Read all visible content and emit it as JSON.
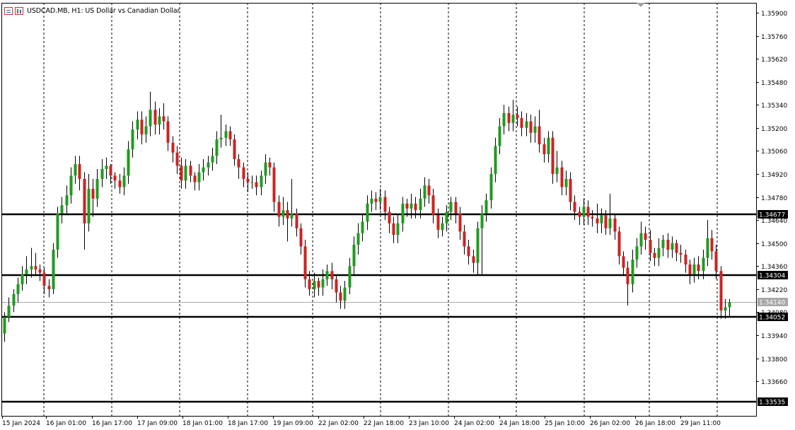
{
  "header": {
    "title": "USDCAD.MB, H1:  US Dollar vs Canadian Dollar",
    "icons": [
      "one-click-trading-icon",
      "chart-bars-icon"
    ]
  },
  "colors": {
    "bull": "#1f9b1f",
    "bear": "#cc2222",
    "wick": "#000000",
    "grid": "#000000",
    "level_line": "#000000",
    "bid_line": "#a8a8a8"
  },
  "chart_data": {
    "type": "candlestick",
    "title": "USDCAD.MB, H1:  US Dollar vs Canadian Dollar",
    "symbol": "USDCAD.MB",
    "timeframe": "H1",
    "ylim": [
      1.3345,
      1.3596
    ],
    "y_ticks": [
      "1.35900",
      "1.35760",
      "1.35620",
      "1.35480",
      "1.35340",
      "1.35200",
      "1.35060",
      "1.34920",
      "1.34780",
      "1.34640",
      "1.34500",
      "1.34360",
      "1.34220",
      "1.34080",
      "1.33940",
      "1.33800",
      "1.33660"
    ],
    "x_ticks": [
      "15 Jan 2024",
      "16 Jan 01:00",
      "16 Jan 17:00",
      "17 Jan 09:00",
      "18 Jan 01:00",
      "18 Jan 17:00",
      "19 Jan 09:00",
      "22 Jan 02:00",
      "22 Jan 18:00",
      "23 Jan 10:00",
      "24 Jan 02:00",
      "24 Jan 18:00",
      "25 Jan 10:00",
      "26 Jan 02:00",
      "26 Jan 18:00",
      "29 Jan 11:00"
    ],
    "grid": "vertical dashed",
    "levels": [
      "1.34677",
      "1.34304",
      "1.34052",
      "1.33535"
    ],
    "current_price": "1.34140",
    "candles": [
      [
        1.3395,
        1.3405,
        1.339,
        1.3408
      ],
      [
        1.3405,
        1.3412,
        1.3402,
        1.3417
      ],
      [
        1.3412,
        1.3419,
        1.3408,
        1.3422
      ],
      [
        1.3419,
        1.3425,
        1.3414,
        1.3429
      ],
      [
        1.3425,
        1.3431,
        1.3421,
        1.3436
      ],
      [
        1.3431,
        1.3434,
        1.3425,
        1.3442
      ],
      [
        1.3434,
        1.3436,
        1.3429,
        1.3447
      ],
      [
        1.3436,
        1.3434,
        1.343,
        1.3444
      ],
      [
        1.3434,
        1.3432,
        1.3427,
        1.3437
      ],
      [
        1.3432,
        1.3424,
        1.3419,
        1.3435
      ],
      [
        1.3424,
        1.3422,
        1.3417,
        1.3428
      ],
      [
        1.3422,
        1.3446,
        1.3419,
        1.345
      ],
      [
        1.3446,
        1.3468,
        1.3441,
        1.3472
      ],
      [
        1.3468,
        1.3473,
        1.3462,
        1.3478
      ],
      [
        1.3473,
        1.3479,
        1.3467,
        1.3485
      ],
      [
        1.3479,
        1.3491,
        1.3474,
        1.3496
      ],
      [
        1.3491,
        1.3498,
        1.3486,
        1.3503
      ],
      [
        1.3498,
        1.3489,
        1.3482,
        1.3503
      ],
      [
        1.3489,
        1.3462,
        1.3446,
        1.3493
      ],
      [
        1.3462,
        1.3483,
        1.3457,
        1.3492
      ],
      [
        1.3483,
        1.3477,
        1.3466,
        1.3489
      ],
      [
        1.3477,
        1.3489,
        1.3472,
        1.3495
      ],
      [
        1.3489,
        1.3495,
        1.3484,
        1.3501
      ],
      [
        1.3495,
        1.3497,
        1.3489,
        1.3502
      ],
      [
        1.3497,
        1.3491,
        1.3486,
        1.3498
      ],
      [
        1.3491,
        1.3488,
        1.3483,
        1.3493
      ],
      [
        1.3488,
        1.3484,
        1.348,
        1.3492
      ],
      [
        1.3484,
        1.3491,
        1.3479,
        1.3496
      ],
      [
        1.3491,
        1.3507,
        1.3486,
        1.3512
      ],
      [
        1.3507,
        1.3519,
        1.3502,
        1.3524
      ],
      [
        1.3519,
        1.3525,
        1.3513,
        1.353
      ],
      [
        1.3525,
        1.3516,
        1.351,
        1.353
      ],
      [
        1.3516,
        1.3521,
        1.3511,
        1.3527
      ],
      [
        1.3521,
        1.3531,
        1.3515,
        1.3542
      ],
      [
        1.3531,
        1.3522,
        1.3516,
        1.3536
      ],
      [
        1.3522,
        1.3527,
        1.3516,
        1.3532
      ],
      [
        1.3527,
        1.3524,
        1.3519,
        1.3535
      ],
      [
        1.3524,
        1.3511,
        1.3506,
        1.3527
      ],
      [
        1.3511,
        1.3505,
        1.3499,
        1.3515
      ],
      [
        1.3505,
        1.3497,
        1.3492,
        1.3509
      ],
      [
        1.3497,
        1.3488,
        1.3483,
        1.3502
      ],
      [
        1.3488,
        1.3497,
        1.3483,
        1.3501
      ],
      [
        1.3497,
        1.3491,
        1.3487,
        1.35
      ],
      [
        1.3491,
        1.3487,
        1.3482,
        1.3493
      ],
      [
        1.3487,
        1.3493,
        1.3482,
        1.3498
      ],
      [
        1.3493,
        1.3496,
        1.3488,
        1.3501
      ],
      [
        1.3496,
        1.3499,
        1.3491,
        1.3503
      ],
      [
        1.3499,
        1.3503,
        1.3494,
        1.3508
      ],
      [
        1.3503,
        1.3513,
        1.3498,
        1.3518
      ],
      [
        1.3513,
        1.3514,
        1.3508,
        1.3528
      ],
      [
        1.3514,
        1.3518,
        1.3509,
        1.3522
      ],
      [
        1.3518,
        1.3513,
        1.3509,
        1.3521
      ],
      [
        1.3513,
        1.3501,
        1.3497,
        1.3516
      ],
      [
        1.3501,
        1.3496,
        1.3489,
        1.3504
      ],
      [
        1.3496,
        1.3489,
        1.3484,
        1.3499
      ],
      [
        1.3489,
        1.3487,
        1.3481,
        1.3493
      ],
      [
        1.3487,
        1.3487,
        1.3483,
        1.3491
      ],
      [
        1.3487,
        1.3484,
        1.3479,
        1.3491
      ],
      [
        1.3484,
        1.3491,
        1.3479,
        1.3494
      ],
      [
        1.3491,
        1.3499,
        1.3486,
        1.3504
      ],
      [
        1.3499,
        1.3496,
        1.3491,
        1.3502
      ],
      [
        1.3496,
        1.3475,
        1.3469,
        1.3499
      ],
      [
        1.3475,
        1.3466,
        1.346,
        1.3479
      ],
      [
        1.3466,
        1.347,
        1.3461,
        1.3478
      ],
      [
        1.347,
        1.3465,
        1.3451,
        1.3475
      ],
      [
        1.3465,
        1.3468,
        1.346,
        1.3489
      ],
      [
        1.3468,
        1.3459,
        1.3454,
        1.3471
      ],
      [
        1.3459,
        1.3448,
        1.3443,
        1.3462
      ],
      [
        1.3448,
        1.3428,
        1.3423,
        1.3452
      ],
      [
        1.3428,
        1.3422,
        1.3418,
        1.3433
      ],
      [
        1.3422,
        1.3427,
        1.3417,
        1.3432
      ],
      [
        1.3427,
        1.3423,
        1.3418,
        1.3429
      ],
      [
        1.3423,
        1.3428,
        1.3418,
        1.3434
      ],
      [
        1.3428,
        1.3433,
        1.3424,
        1.3437
      ],
      [
        1.3433,
        1.3428,
        1.3422,
        1.3438
      ],
      [
        1.3428,
        1.342,
        1.3414,
        1.3431
      ],
      [
        1.342,
        1.3415,
        1.341,
        1.3424
      ],
      [
        1.3415,
        1.3423,
        1.341,
        1.3427
      ],
      [
        1.3423,
        1.3436,
        1.3419,
        1.3441
      ],
      [
        1.3436,
        1.3449,
        1.343,
        1.3454
      ],
      [
        1.3449,
        1.3456,
        1.3443,
        1.3462
      ],
      [
        1.3456,
        1.3463,
        1.3451,
        1.3468
      ],
      [
        1.3463,
        1.3474,
        1.3458,
        1.3479
      ],
      [
        1.3474,
        1.3477,
        1.3469,
        1.3482
      ],
      [
        1.3477,
        1.3475,
        1.347,
        1.3481
      ],
      [
        1.3475,
        1.3478,
        1.347,
        1.3483
      ],
      [
        1.3478,
        1.3469,
        1.3464,
        1.3482
      ],
      [
        1.3469,
        1.3462,
        1.3456,
        1.3472
      ],
      [
        1.3462,
        1.3455,
        1.345,
        1.3466
      ],
      [
        1.3455,
        1.3462,
        1.345,
        1.3467
      ],
      [
        1.3462,
        1.3474,
        1.3457,
        1.3478
      ],
      [
        1.3474,
        1.3471,
        1.3466,
        1.3477
      ],
      [
        1.3471,
        1.3474,
        1.3465,
        1.348
      ],
      [
        1.3474,
        1.347,
        1.3465,
        1.3478
      ],
      [
        1.347,
        1.3477,
        1.3465,
        1.3483
      ],
      [
        1.3477,
        1.3485,
        1.3472,
        1.349
      ],
      [
        1.3485,
        1.3479,
        1.3474,
        1.3489
      ],
      [
        1.3479,
        1.3467,
        1.3462,
        1.3483
      ],
      [
        1.3467,
        1.3458,
        1.3453,
        1.3471
      ],
      [
        1.3458,
        1.3462,
        1.3454,
        1.3466
      ],
      [
        1.3462,
        1.3469,
        1.3457,
        1.3473
      ],
      [
        1.3469,
        1.3475,
        1.3464,
        1.3478
      ],
      [
        1.3475,
        1.3468,
        1.3462,
        1.3478
      ],
      [
        1.3468,
        1.3457,
        1.3452,
        1.3472
      ],
      [
        1.3457,
        1.3448,
        1.3443,
        1.3461
      ],
      [
        1.3448,
        1.3442,
        1.3437,
        1.3452
      ],
      [
        1.3442,
        1.3438,
        1.3432,
        1.3446
      ],
      [
        1.3438,
        1.3459,
        1.3431,
        1.3463
      ],
      [
        1.3459,
        1.3468,
        1.3431,
        1.3473
      ],
      [
        1.3468,
        1.3476,
        1.3463,
        1.348
      ],
      [
        1.3476,
        1.3492,
        1.3471,
        1.3496
      ],
      [
        1.3492,
        1.3509,
        1.3487,
        1.3514
      ],
      [
        1.3509,
        1.3521,
        1.3504,
        1.3526
      ],
      [
        1.3521,
        1.3529,
        1.3516,
        1.3534
      ],
      [
        1.3529,
        1.3523,
        1.3518,
        1.3533
      ],
      [
        1.3523,
        1.3528,
        1.3518,
        1.3537
      ],
      [
        1.3528,
        1.3526,
        1.3521,
        1.3533
      ],
      [
        1.3526,
        1.352,
        1.3515,
        1.353
      ],
      [
        1.352,
        1.3524,
        1.3515,
        1.3529
      ],
      [
        1.3524,
        1.3517,
        1.3511,
        1.3528
      ],
      [
        1.3517,
        1.3521,
        1.3511,
        1.3527
      ],
      [
        1.3521,
        1.351,
        1.3505,
        1.3531
      ],
      [
        1.351,
        1.3504,
        1.3499,
        1.3514
      ],
      [
        1.3504,
        1.3514,
        1.3499,
        1.3518
      ],
      [
        1.3514,
        1.3492,
        1.3486,
        1.3518
      ],
      [
        1.3492,
        1.3496,
        1.3487,
        1.3506
      ],
      [
        1.3496,
        1.3484,
        1.3479,
        1.35
      ],
      [
        1.3484,
        1.3489,
        1.3479,
        1.3494
      ],
      [
        1.3489,
        1.3475,
        1.347,
        1.3493
      ],
      [
        1.3475,
        1.3469,
        1.3464,
        1.3479
      ],
      [
        1.3469,
        1.3466,
        1.3461,
        1.3472
      ],
      [
        1.3466,
        1.3472,
        1.3461,
        1.3477
      ],
      [
        1.3472,
        1.3466,
        1.3461,
        1.3476
      ],
      [
        1.3466,
        1.3465,
        1.346,
        1.347
      ],
      [
        1.3465,
        1.3462,
        1.3456,
        1.3474
      ],
      [
        1.3462,
        1.3467,
        1.3456,
        1.3471
      ],
      [
        1.3467,
        1.3459,
        1.3455,
        1.347
      ],
      [
        1.3459,
        1.3465,
        1.3455,
        1.348
      ],
      [
        1.3465,
        1.3457,
        1.3452,
        1.3468
      ],
      [
        1.3457,
        1.3442,
        1.3437,
        1.346
      ],
      [
        1.3442,
        1.3435,
        1.343,
        1.3445
      ],
      [
        1.3435,
        1.3425,
        1.3412,
        1.3439
      ],
      [
        1.3425,
        1.344,
        1.342,
        1.3446
      ],
      [
        1.344,
        1.3448,
        1.3435,
        1.3453
      ],
      [
        1.3448,
        1.3456,
        1.3443,
        1.3463
      ],
      [
        1.3456,
        1.3452,
        1.3446,
        1.346
      ],
      [
        1.3452,
        1.3444,
        1.3439,
        1.3458
      ],
      [
        1.3444,
        1.3441,
        1.3436,
        1.3447
      ],
      [
        1.3441,
        1.3447,
        1.3436,
        1.3453
      ],
      [
        1.3447,
        1.3452,
        1.3442,
        1.3455
      ],
      [
        1.3452,
        1.3446,
        1.3441,
        1.3456
      ],
      [
        1.3446,
        1.345,
        1.3441,
        1.3454
      ],
      [
        1.345,
        1.3444,
        1.3439,
        1.3452
      ],
      [
        1.3444,
        1.3443,
        1.3438,
        1.3449
      ],
      [
        1.3443,
        1.3437,
        1.3432,
        1.3446
      ],
      [
        1.3437,
        1.3431,
        1.3425,
        1.344
      ],
      [
        1.3431,
        1.3437,
        1.3426,
        1.3441
      ],
      [
        1.3437,
        1.3433,
        1.3428,
        1.3442
      ],
      [
        1.3433,
        1.3441,
        1.3428,
        1.3446
      ],
      [
        1.3441,
        1.3453,
        1.3436,
        1.3464
      ],
      [
        1.3453,
        1.3445,
        1.344,
        1.3458
      ],
      [
        1.3445,
        1.3433,
        1.3428,
        1.3449
      ],
      [
        1.3433,
        1.3409,
        1.3404,
        1.3436
      ],
      [
        1.3409,
        1.3411,
        1.3404,
        1.3416
      ],
      [
        1.3411,
        1.3414,
        1.3405,
        1.3416
      ]
    ]
  }
}
